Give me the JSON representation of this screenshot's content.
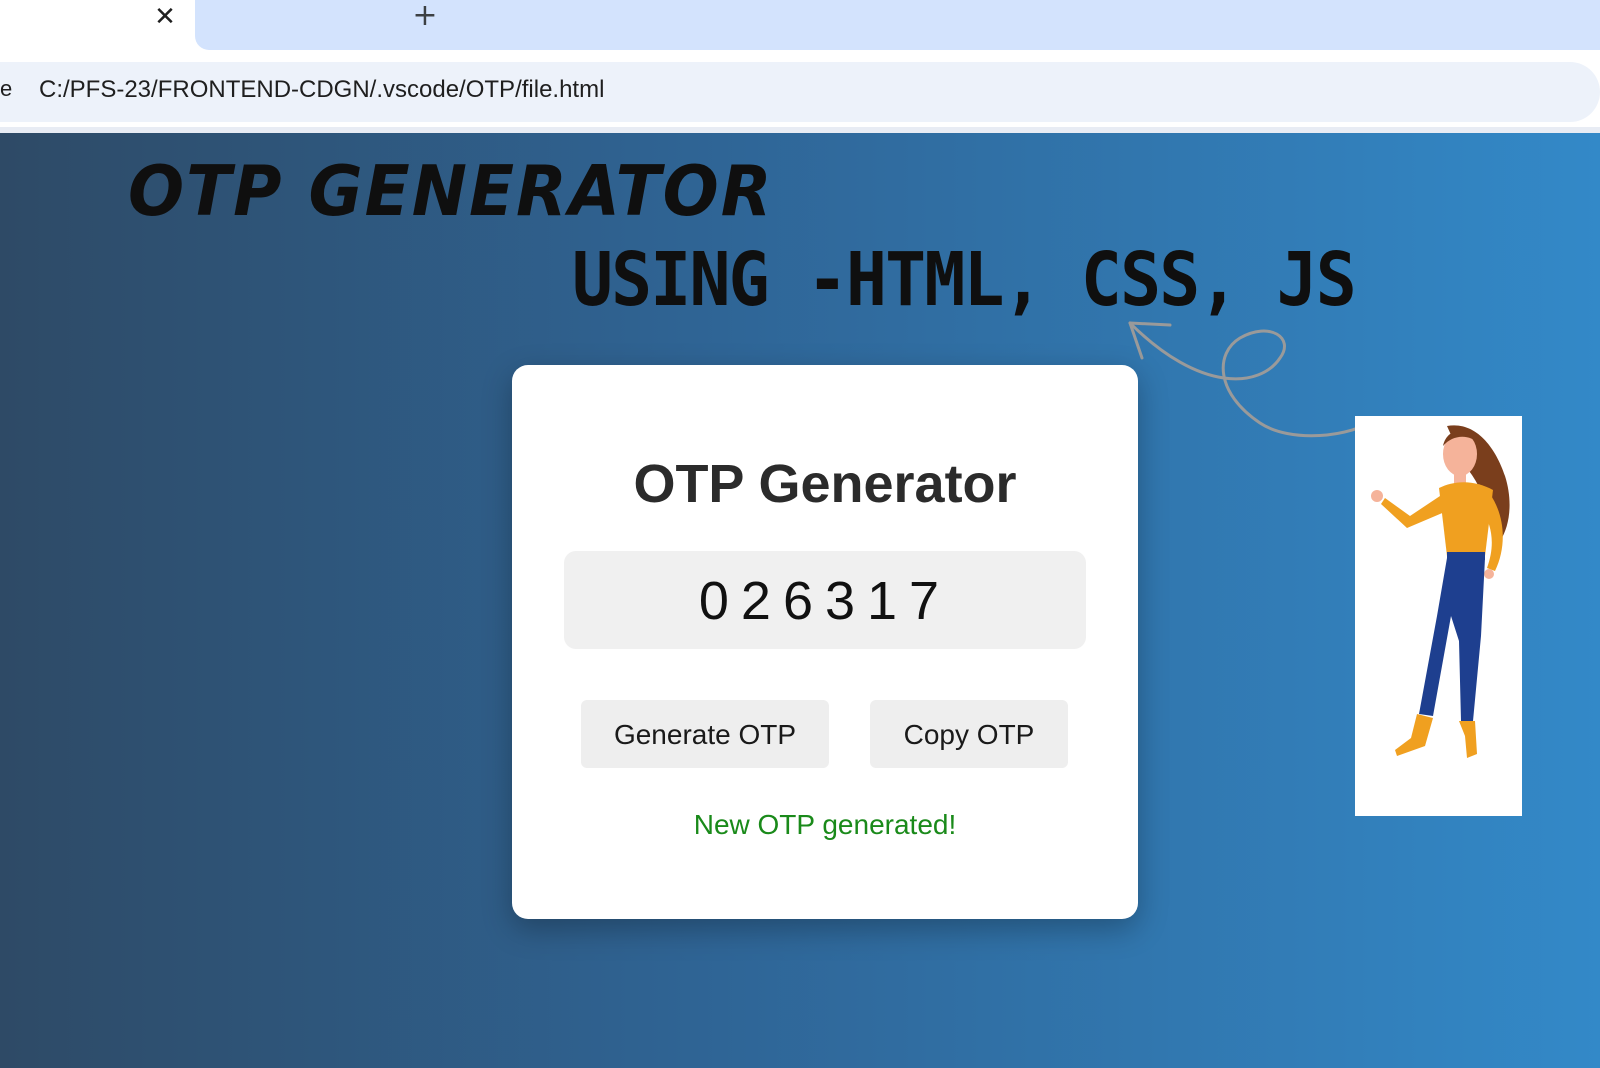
{
  "browser": {
    "tab_close": "✕",
    "new_tab": "+",
    "address_prefix": "e",
    "url": "C:/PFS-23/FRONTEND-CDGN/.vscode/OTP/file.html"
  },
  "banner": {
    "title": "OTP GENERATOR",
    "subtitle": "USING -HTML, CSS, JS"
  },
  "card": {
    "title": "OTP Generator",
    "otp": "026317",
    "generate_label": "Generate OTP",
    "copy_label": "Copy OTP",
    "status": "New OTP generated!"
  },
  "colors": {
    "status_text": "#1a8a1a",
    "gradient_start": "#2e4a66",
    "gradient_end": "#3389c8"
  },
  "icons": {
    "tab_close": "close-icon",
    "new_tab": "plus-icon",
    "doodle": "curly-arrow",
    "figure": "woman-pointing-illustration"
  }
}
